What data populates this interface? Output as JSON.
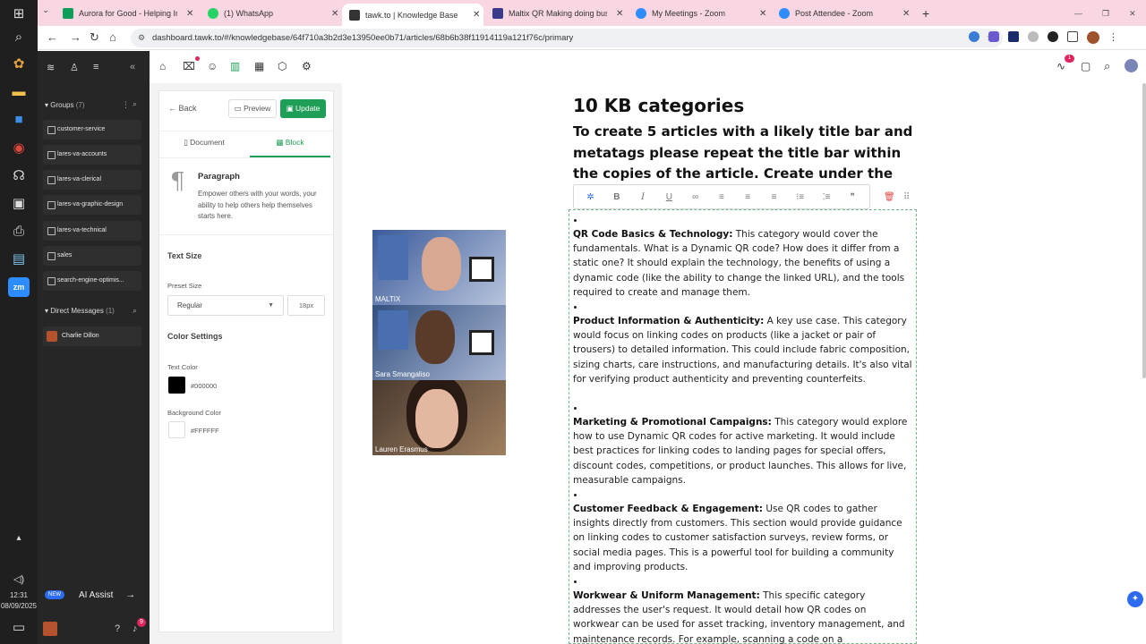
{
  "browser": {
    "tabs": [
      {
        "title": "Aurora for Good - Helping Imp",
        "color": "#0f9d58"
      },
      {
        "title": "(1) WhatsApp",
        "color": "#25d366"
      },
      {
        "title": "tawk.to | Knowledge Base",
        "color": "#333"
      },
      {
        "title": "Maltix QR Making doing busine",
        "color": "#3a3a8c"
      },
      {
        "title": "My Meetings - Zoom",
        "color": "#2d8cff"
      },
      {
        "title": "Post Attendee - Zoom",
        "color": "#2d8cff"
      }
    ],
    "url": "dashboard.tawk.to/#/knowledgebase/64f710a3b2d3e13950ee0b71/articles/68b6b38f11914119a121f76c/primary"
  },
  "taskbar": {
    "time": "12:31",
    "date": "08/09/2025"
  },
  "sidebar": {
    "groups_label": "Groups",
    "groups_count": "(7)",
    "groups": [
      "customer-service",
      "lares-va-accounts",
      "lares-va-clerical",
      "lares-va-graphic-design",
      "lares-va-technical",
      "sales",
      "search-engine-optimis..."
    ],
    "dm_label": "Direct Messages",
    "dm_count": "(1)",
    "dms": [
      "Charlie Dillon"
    ],
    "ai_badge": "NEW",
    "ai_label": "AI Assist",
    "notif_count": "9"
  },
  "panel": {
    "back": "Back",
    "preview": "Preview",
    "update": "Update",
    "tab_document": "Document",
    "tab_block": "Block",
    "block_name": "Paragraph",
    "block_desc": "Empower others with your words, your ability to help others help themselves starts here.",
    "text_size": "Text Size",
    "preset_size": "Preset Size",
    "preset_value": "Regular",
    "px_value": "18px",
    "color_settings": "Color Settings",
    "text_color_label": "Text Color",
    "text_color": "#000000",
    "bg_color_label": "Background Color",
    "bg_color": "#FFFFFF"
  },
  "video": {
    "names": [
      "MALTIX",
      "Sara Smangaliso",
      "Lauren Erasmus"
    ]
  },
  "topbar": {
    "badge": "1"
  },
  "doc": {
    "title": "10 KB categories",
    "subtitle": "To create 5 articles with a likely title bar and metatags please repeat the title bar within the copies of the article. Create under the themes",
    "items": [
      {
        "head": "QR Code Basics & Technology:",
        "body": " This category would cover the fundamentals. What is a Dynamic QR code? How does it differ from a static one? It should explain the technology, the benefits of using a dynamic code (like the ability to change the linked URL), and the tools required to create and manage them."
      },
      {
        "head": "Product Information & Authenticity:",
        "body": " A key use case. This category would focus on linking codes on products (like a jacket or pair of trousers) to detailed information. This could include fabric composition, sizing charts, care instructions, and manufacturing details. It's also vital for verifying product authenticity and preventing counterfeits."
      },
      {
        "head": "Marketing & Promotional Campaigns:",
        "body": " This category would explore how to use Dynamic QR codes for active marketing. It would include best practices for linking codes to landing pages for special offers, discount codes, competitions, or product launches. This allows for live, measurable campaigns."
      },
      {
        "head": "Customer Feedback & Engagement:",
        "body": " Use QR codes to gather insights directly from customers. This section would provide guidance on linking codes to customer satisfaction surveys, review forms, or social media pages. This is a powerful tool for building a community and improving products."
      },
      {
        "head": "Workwear & Uniform Management:",
        "body": " This specific category addresses the user's request. It would detail how QR codes on workwear can be used for asset tracking, inventory management, and maintenance records. For example, scanning a code on a"
      }
    ]
  }
}
